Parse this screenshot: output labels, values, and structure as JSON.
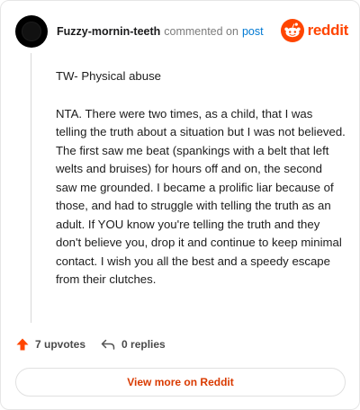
{
  "comment": {
    "username": "Fuzzy-mornin-teeth",
    "commented_on": "commented on",
    "post_link": "post",
    "brand": "reddit",
    "paragraphs": [
      "TW- Physical abuse",
      "NTA. There were two times, as a child, that I was telling the truth about a situation but I was not believed. The first saw me beat (spankings with a belt that left welts and bruises) for hours off and on, the second saw me grounded. I became a prolific liar because of those, and had to struggle with telling the truth as an adult. If YOU know you're telling the truth and they don't believe you, drop it and continue to keep minimal contact. I wish you all the best and a speedy escape from their clutches."
    ],
    "upvotes_label": "7 upvotes",
    "replies_label": "0 replies",
    "view_button_label": "View more on Reddit"
  },
  "colors": {
    "brand": "#ff4500",
    "link": "#0079d3",
    "upvote": "#ff4500",
    "view_button_text": "#d93a00"
  },
  "icons": {
    "avatar": "avatar",
    "brand": "reddit-snoo-icon",
    "upvote": "upvote-arrow-icon",
    "reply": "reply-arrow-icon"
  }
}
